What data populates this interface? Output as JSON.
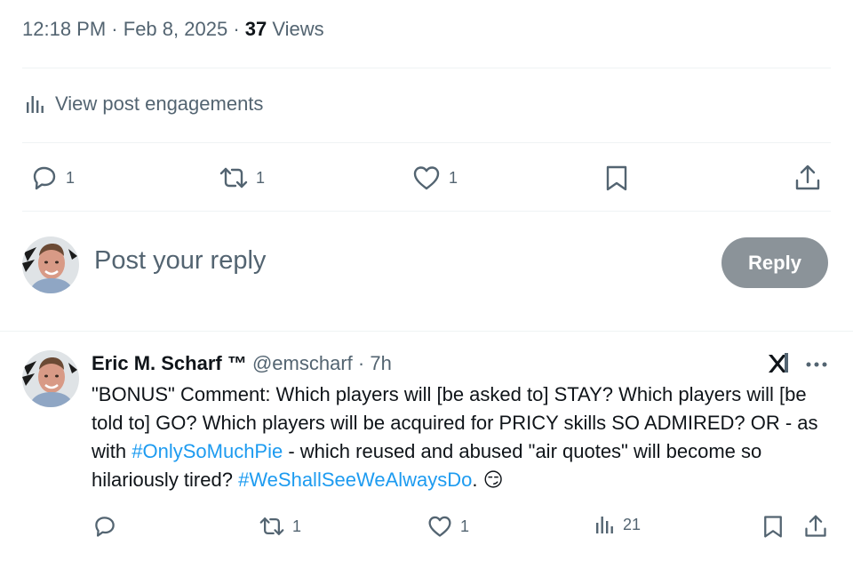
{
  "post_meta": {
    "time": "12:18 PM",
    "separator": "·",
    "date": "Feb 8, 2025",
    "views_count": "37",
    "views_label": "Views"
  },
  "engagements": {
    "label": "View post engagements",
    "icon": "analytics-icon"
  },
  "main_actions": {
    "replies": "1",
    "reposts": "1",
    "likes": "1",
    "icons": [
      "reply-icon",
      "repost-icon",
      "like-icon",
      "bookmark-icon",
      "share-icon"
    ]
  },
  "reply_composer": {
    "placeholder": "Post your reply",
    "button_label": "Reply",
    "button_color": "#8b9399"
  },
  "reply_post": {
    "author_name": "Eric M. Scharf ™",
    "handle": "@emscharf",
    "separator": "·",
    "time_ago": "7h",
    "text_1": "\"BONUS\" Comment: Which players will [be asked to] STAY? Which players will [be told to] GO? Which players will be acquired for PRICY skills SO ADMIRED? OR - as with ",
    "hashtag_1": "#OnlySoMuchPie",
    "text_2": " - which reused and abused \"air quotes\" will become so hilariously tired? ",
    "hashtag_2": "#WeShallSeeWeAlwaysDo",
    "text_3": ".",
    "emoji": "😏",
    "actions": {
      "replies": "",
      "reposts": "1",
      "likes": "1",
      "views": "21"
    }
  },
  "colors": {
    "text_primary": "#0f1419",
    "text_secondary": "#536471",
    "hashtag": "#1d9bf0",
    "divider": "#eff3f4"
  }
}
